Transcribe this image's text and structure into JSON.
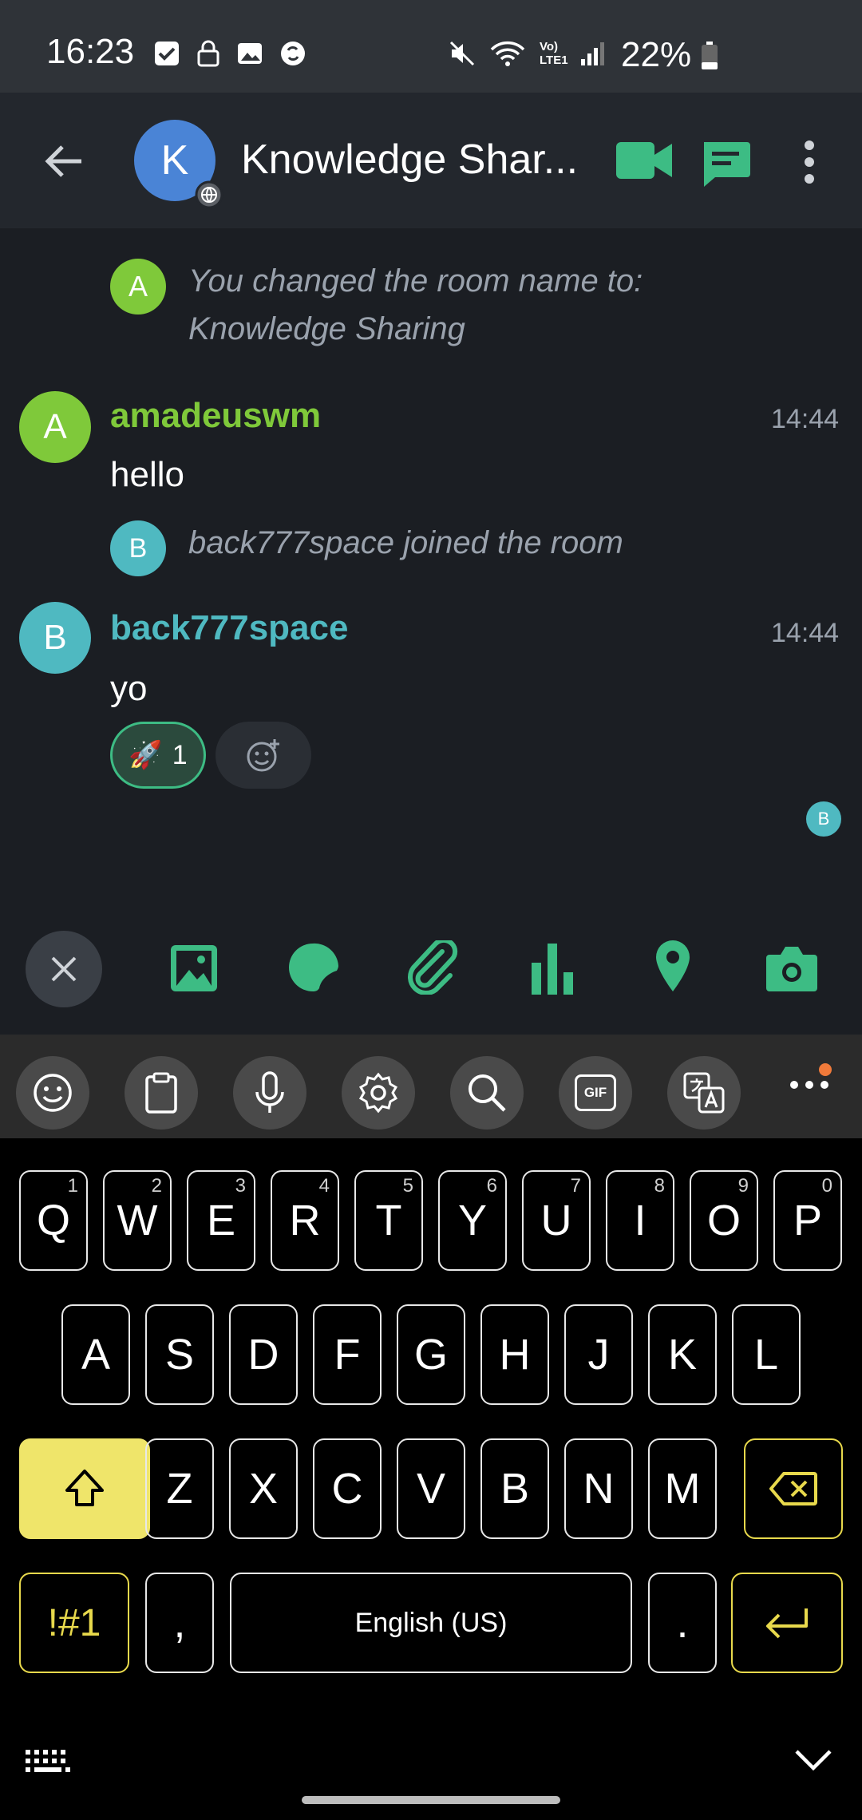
{
  "status_bar": {
    "time": "16:23",
    "battery": "22%",
    "network": "Vo) LTE1"
  },
  "header": {
    "avatar_letter": "K",
    "title": "Knowledge Shar...",
    "back": "back",
    "colors": {
      "accent": "#3dbc84",
      "bg": "#23272d"
    }
  },
  "timeline": {
    "system_1": {
      "avatar": "A",
      "line1": "You changed the room name to:",
      "line2": "Knowledge Sharing"
    },
    "msg_1": {
      "avatar": "A",
      "sender": "amadeuswm",
      "time": "14:44",
      "text": "hello",
      "color": "#7fc93a"
    },
    "system_2": {
      "avatar": "B",
      "text": "back777space joined the room"
    },
    "msg_2": {
      "avatar": "B",
      "sender": "back777space",
      "time": "14:44",
      "text": "yo",
      "color": "#4fb9c1",
      "reaction_emoji": "🚀",
      "reaction_count": "1"
    },
    "read_receipt": "B"
  },
  "attach_bar": {
    "items": [
      "close-icon",
      "image-icon",
      "sticker-icon",
      "attachment-icon",
      "poll-icon",
      "location-icon",
      "camera-icon"
    ]
  },
  "keyboard": {
    "toolbar": [
      "emoji-icon",
      "clipboard-icon",
      "mic-icon",
      "settings-icon",
      "search-icon",
      "gif-icon",
      "translate-icon",
      "more-icon"
    ],
    "gif_label": "GIF",
    "row1": [
      "Q",
      "W",
      "E",
      "R",
      "T",
      "Y",
      "U",
      "I",
      "O",
      "P"
    ],
    "row1_hints": [
      "1",
      "2",
      "3",
      "4",
      "5",
      "6",
      "7",
      "8",
      "9",
      "0"
    ],
    "row2": [
      "A",
      "S",
      "D",
      "F",
      "G",
      "H",
      "J",
      "K",
      "L"
    ],
    "row3": [
      "Z",
      "X",
      "C",
      "V",
      "B",
      "N",
      "M"
    ],
    "symbols": "!#1",
    "comma": ",",
    "space": "English (US)",
    "period": "."
  }
}
